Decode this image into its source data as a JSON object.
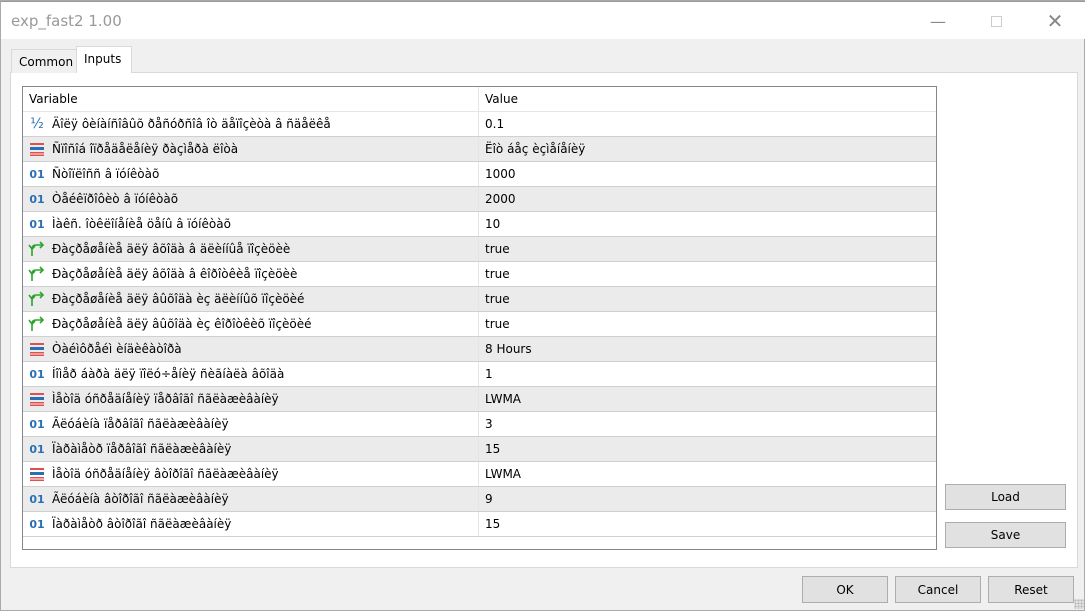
{
  "window": {
    "title": "exp_fast2 1.00",
    "min_icon": "minimize-icon",
    "max_icon": "maximize-icon",
    "close_icon": "close-icon"
  },
  "tabs": [
    {
      "label": "Common",
      "active": false
    },
    {
      "label": "Inputs",
      "active": true
    }
  ],
  "table": {
    "headers": {
      "variable": "Variable",
      "value": "Value"
    },
    "rows": [
      {
        "type": "double",
        "name": "Äîëÿ ôèíàíñîâûõ ðåñóðñîâ îò äåïîçèòà â ñäåëêå",
        "value": "0.1"
      },
      {
        "type": "enum",
        "name": "Ñïîñîá îïðåäåëåíèÿ ðàçìåðà ëîòà",
        "value": "Ëîò áåç èçìåíåíèÿ"
      },
      {
        "type": "int",
        "name": "Ñòîïëîññ â ïóíêòàõ",
        "value": "1000"
      },
      {
        "type": "int",
        "name": "Òåéêïðîôèò â ïóíêòàõ",
        "value": "2000"
      },
      {
        "type": "int",
        "name": "Ìàêñ. îòêëîíåíèå öåíû â ïóíêòàõ",
        "value": "10"
      },
      {
        "type": "bool",
        "name": "Ðàçðåøåíèå äëÿ âõîäà â äëèííûå ïîçèöèè",
        "value": "true"
      },
      {
        "type": "bool",
        "name": "Ðàçðåøåíèå äëÿ âõîäà â êîðîòêèå ïîçèöèè",
        "value": "true"
      },
      {
        "type": "bool",
        "name": "Ðàçðåøåíèå äëÿ âûõîäà èç äëèííûõ ïîçèöèé",
        "value": "true"
      },
      {
        "type": "bool",
        "name": "Ðàçðåøåíèå äëÿ âûõîäà èç êîðîòêèõ ïîçèöèé",
        "value": "true"
      },
      {
        "type": "enum",
        "name": "Òàéìôðåéì èíäèêàòîðà",
        "value": "8 Hours"
      },
      {
        "type": "int",
        "name": "Íîìåð áàðà äëÿ ïîëó÷åíèÿ ñèãíàëà âõîäà",
        "value": "1"
      },
      {
        "type": "enum",
        "name": "Ìåòîä óñðåäíåíèÿ ïåðâîãî ñãëàæèâàíèÿ",
        "value": "LWMA"
      },
      {
        "type": "int",
        "name": "Ãëóáèíà  ïåðâîãî ñãëàæèâàíèÿ",
        "value": "3"
      },
      {
        "type": "int",
        "name": "Ïàðàìåòð ïåðâîãî ñãëàæèâàíèÿ",
        "value": "15"
      },
      {
        "type": "enum",
        "name": "Ìåòîä óñðåäíåíèÿ âòîðîãî ñãëàæèâàíèÿ",
        "value": "LWMA"
      },
      {
        "type": "int",
        "name": "Ãëóáèíà  âòîðîãî ñãëàæèâàíèÿ",
        "value": "9"
      },
      {
        "type": "int",
        "name": "Ïàðàìåòð âòîðîãî ñãëàæèâàíèÿ",
        "value": "15"
      }
    ]
  },
  "icons": {
    "double": "fraction-icon",
    "enum": "enum-list-icon",
    "int": "integer-icon",
    "bool": "boolean-arrow-icon"
  },
  "colors": {
    "int_icon": "#2a6fb5",
    "bool_icon": "#2aa52a",
    "enum_icon_red": "#e05050"
  },
  "side_buttons": {
    "load": "Load",
    "save": "Save"
  },
  "footer": {
    "ok": "OK",
    "cancel": "Cancel",
    "reset": "Reset"
  }
}
